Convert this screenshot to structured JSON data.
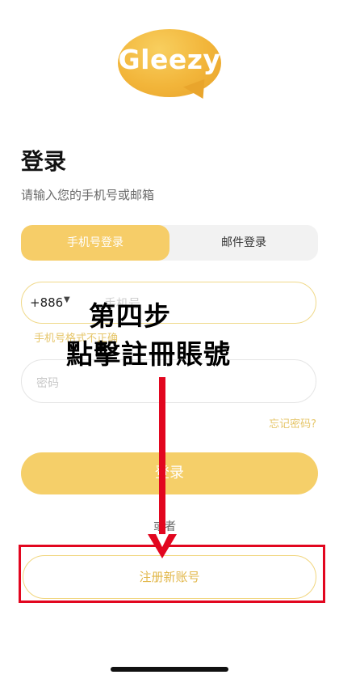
{
  "app": {
    "logo_text": "Gleezy"
  },
  "login": {
    "title": "登录",
    "subtitle": "请输入您的手机号或邮箱",
    "tabs": [
      {
        "label": "手机号登录",
        "active": true
      },
      {
        "label": "邮件登录",
        "active": false
      }
    ],
    "phone": {
      "country_code": "+886",
      "placeholder": "手机号",
      "error": "手机号格式不正确"
    },
    "password": {
      "placeholder": "密码"
    },
    "forgot_label": "忘记密码?",
    "submit_label": "登录",
    "or_label": "或者",
    "register_label": "注册新账号"
  },
  "annotation": {
    "step": "第四步",
    "instruction": "點擊註冊賬號",
    "color": "#e2061f"
  },
  "colors": {
    "accent": "#f5cf69",
    "accent_text": "#e2b84c"
  }
}
